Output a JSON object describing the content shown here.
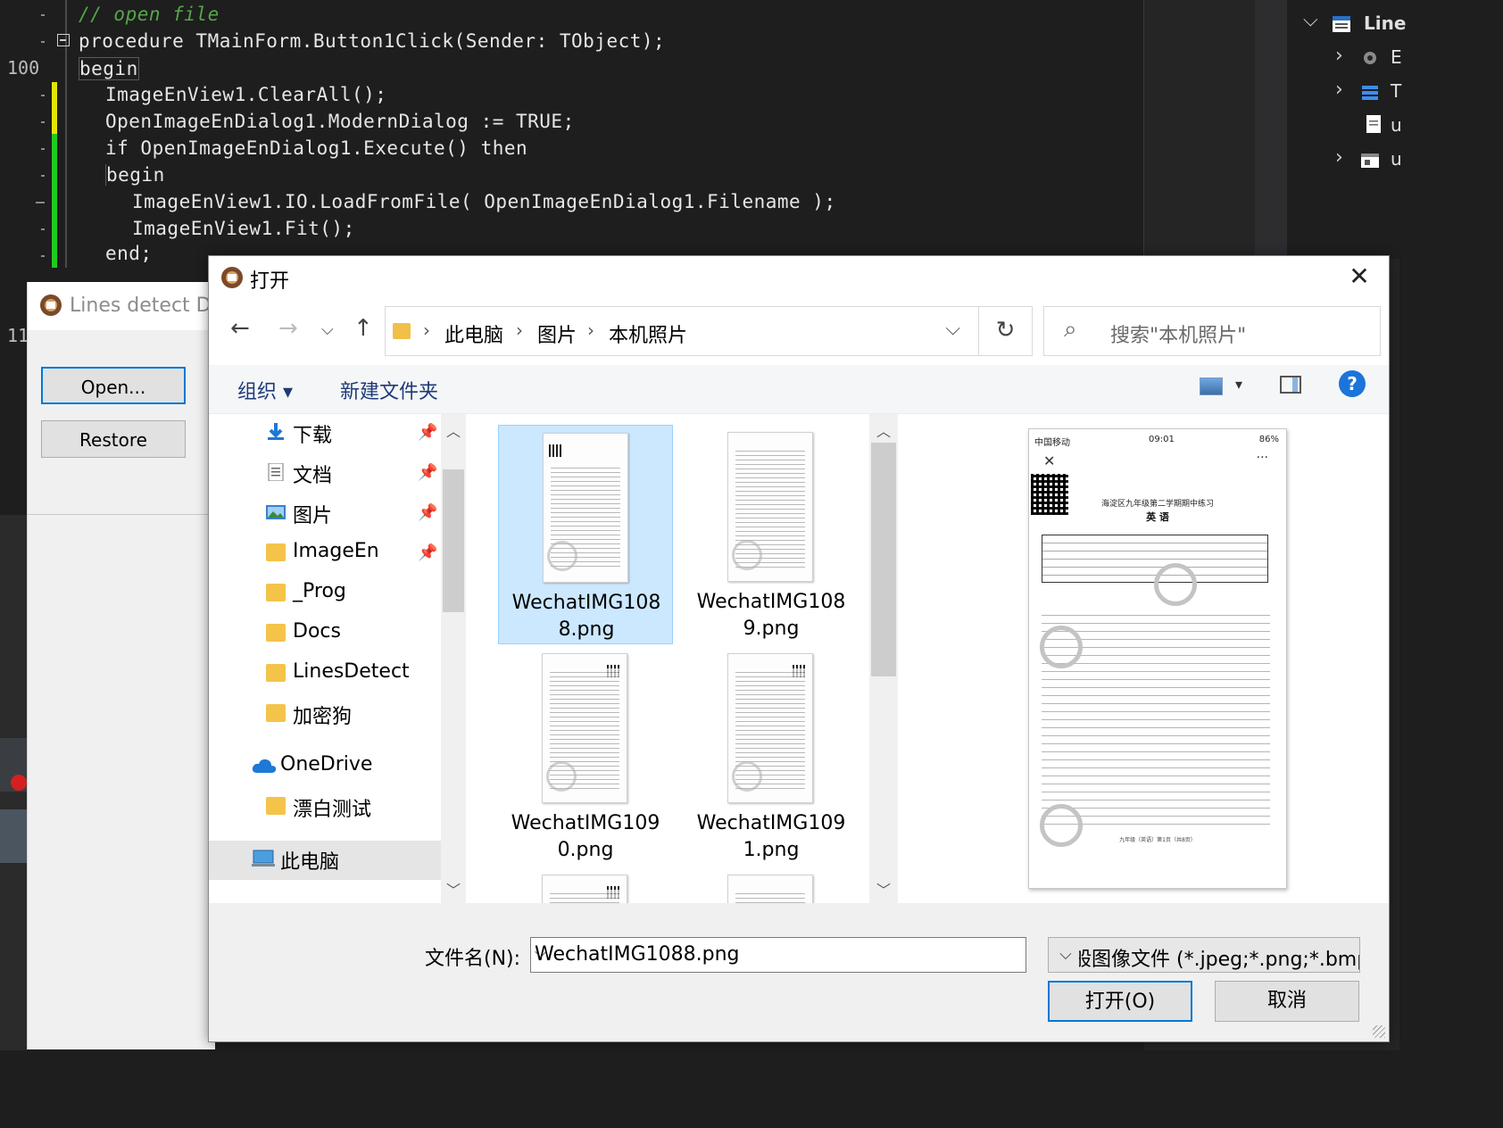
{
  "editor": {
    "line_number": "100",
    "partial_line_numbers": [
      "11",
      "11"
    ],
    "lines": [
      {
        "indent": 0,
        "text": "// open file",
        "kind": "comment"
      },
      {
        "indent": 0,
        "text": "procedure TMainForm.Button1Click(Sender: TObject);",
        "kind": "code"
      },
      {
        "indent": 0,
        "text": "begin",
        "kind": "code"
      },
      {
        "indent": 1,
        "text": "ImageEnView1.ClearAll();",
        "kind": "code"
      },
      {
        "indent": 1,
        "text": "OpenImageEnDialog1.ModernDialog := TRUE;",
        "kind": "code"
      },
      {
        "indent": 1,
        "text": "if OpenImageEnDialog1.Execute() then",
        "kind": "code"
      },
      {
        "indent": 1,
        "text": "begin",
        "kind": "code"
      },
      {
        "indent": 2,
        "text": "ImageEnView1.IO.LoadFromFile( OpenImageEnDialog1.Filename );",
        "kind": "code"
      },
      {
        "indent": 2,
        "text": "ImageEnView1.Fit();",
        "kind": "code"
      },
      {
        "indent": 1,
        "text": "end;",
        "kind": "code"
      }
    ]
  },
  "structure_panel": {
    "root_label": "Line",
    "rows": [
      {
        "label": "E",
        "icon": "gear-icon"
      },
      {
        "label": "T",
        "icon": "layers-icon"
      },
      {
        "label": "u",
        "icon": "document-icon"
      },
      {
        "label": "u",
        "icon": "form-icon"
      }
    ]
  },
  "lines_form": {
    "title": "Lines detect De",
    "open_button": "Open...",
    "restore_button": "Restore"
  },
  "dialog": {
    "title": "打开",
    "close": "✕",
    "breadcrumb": [
      "此电脑",
      "图片",
      "本机照片"
    ],
    "search_placeholder": "搜索\"本机照片\"",
    "toolbar": {
      "organize": "组织 ▾",
      "new_folder": "新建文件夹",
      "help": "?"
    },
    "nav_items": [
      {
        "label": "下载",
        "pinned": true,
        "icon": "download-icon"
      },
      {
        "label": "文档",
        "pinned": true,
        "icon": "documents-icon"
      },
      {
        "label": "图片",
        "pinned": true,
        "icon": "pictures-icon"
      },
      {
        "label": "ImageEn",
        "pinned": true,
        "icon": "folder-icon"
      },
      {
        "label": "_Prog",
        "pinned": false,
        "icon": "folder-icon"
      },
      {
        "label": "Docs",
        "pinned": false,
        "icon": "folder-icon"
      },
      {
        "label": "LinesDetect",
        "pinned": false,
        "icon": "folder-icon"
      },
      {
        "label": "加密狗",
        "pinned": false,
        "icon": "folder-icon"
      },
      {
        "label": "OneDrive",
        "pinned": false,
        "icon": "cloud-icon",
        "root": true
      },
      {
        "label": "漂白测试",
        "pinned": false,
        "icon": "folder-icon"
      },
      {
        "label": "此电脑",
        "pinned": false,
        "icon": "computer-icon",
        "root": true,
        "selected": true
      }
    ],
    "files": [
      {
        "name_line1": "WechatIMG108",
        "name_line2": "8.png",
        "selected": true
      },
      {
        "name_line1": "WechatIMG108",
        "name_line2": "9.png",
        "selected": false
      },
      {
        "name_line1": "WechatIMG109",
        "name_line2": "0.png",
        "selected": false
      },
      {
        "name_line1": "WechatIMG109",
        "name_line2": "1.png",
        "selected": false
      }
    ],
    "preview": {
      "carrier": "中国移动",
      "time": "09:01",
      "battery": "86%",
      "doc_title": "海淀区九年级第二学期期中练习",
      "doc_subject": "英 语",
      "doc_footer": "九年级（英语）第1页（共8页）"
    },
    "filename_label": "文件名(N):",
    "filename_value": "WechatIMG1088.png",
    "filetype_value": "一般图像文件 (*.jpeg;*.png;*.bmp",
    "open_button": "打开(O)",
    "cancel_button": "取消"
  }
}
